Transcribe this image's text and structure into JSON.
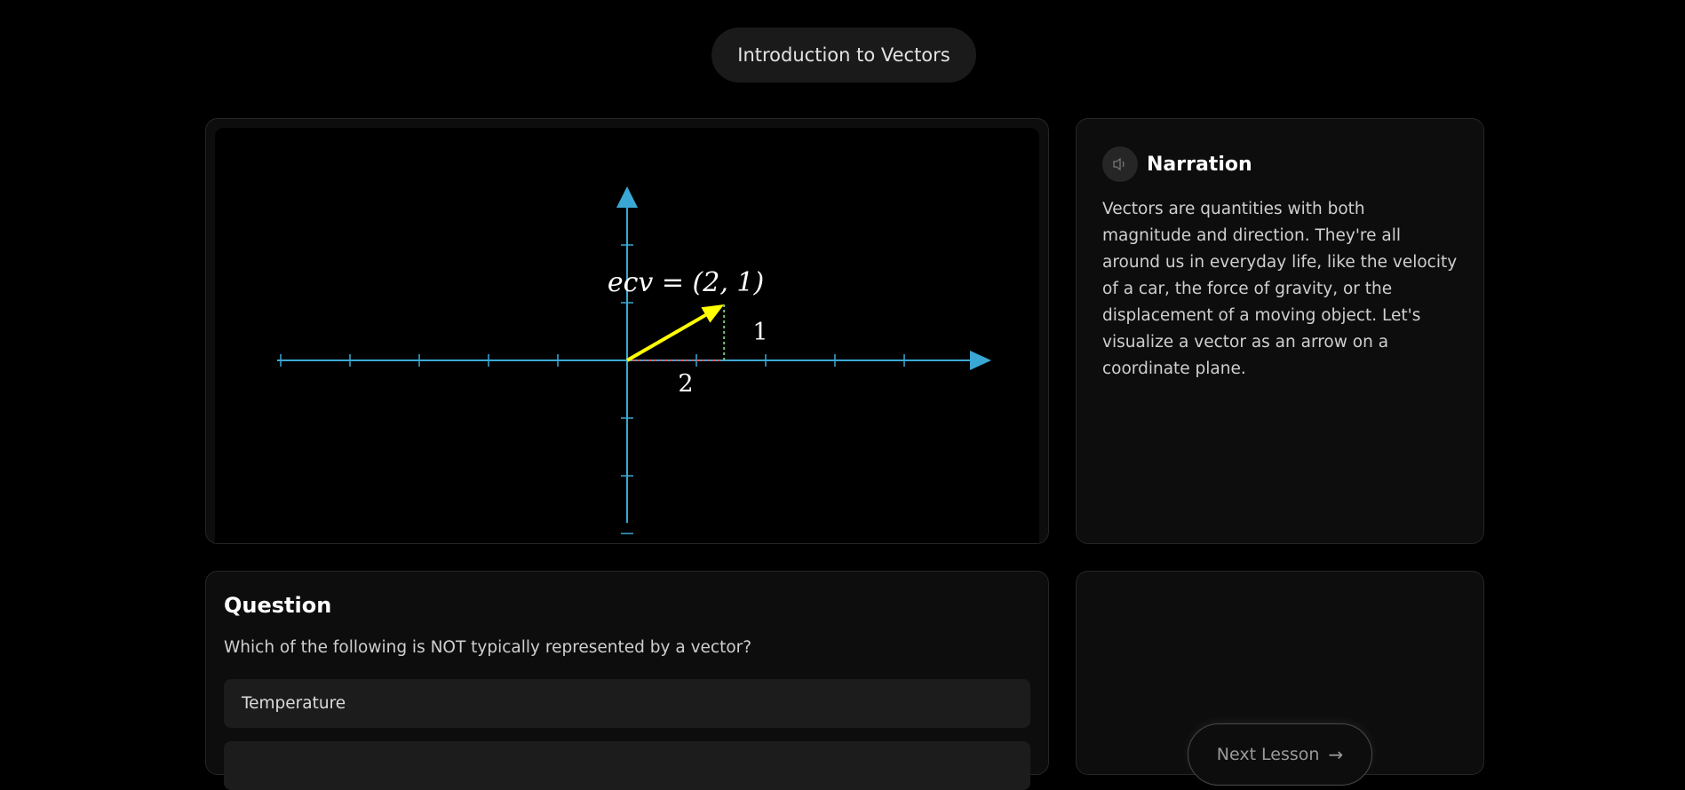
{
  "header": {
    "title": "Introduction to Vectors"
  },
  "animation": {
    "equation": "ecv = (2, 1)",
    "vector": {
      "x": 2,
      "y": 1
    },
    "labels": {
      "x_component": "2",
      "y_component": "1"
    },
    "colors": {
      "axes": "#3aa8d4",
      "vector": "#ffff00",
      "x_dash": "#e05a5a",
      "y_dash": "#7fbf7f"
    }
  },
  "narration": {
    "icon": "speaker-icon",
    "title": "Narration",
    "text": "Vectors are quantities with both magnitude and direction. They're all around us in everyday life, like the velocity of a car, the force of gravity, or the displacement of a moving object. Let's visualize a vector as an arrow on a coordinate plane."
  },
  "question": {
    "title": "Question",
    "text": "Which of the following is NOT typically represented by a vector?",
    "options": [
      {
        "label": "Temperature"
      },
      {
        "label": ""
      }
    ]
  },
  "next": {
    "label": "Next Lesson",
    "icon": "arrow-right-icon"
  }
}
